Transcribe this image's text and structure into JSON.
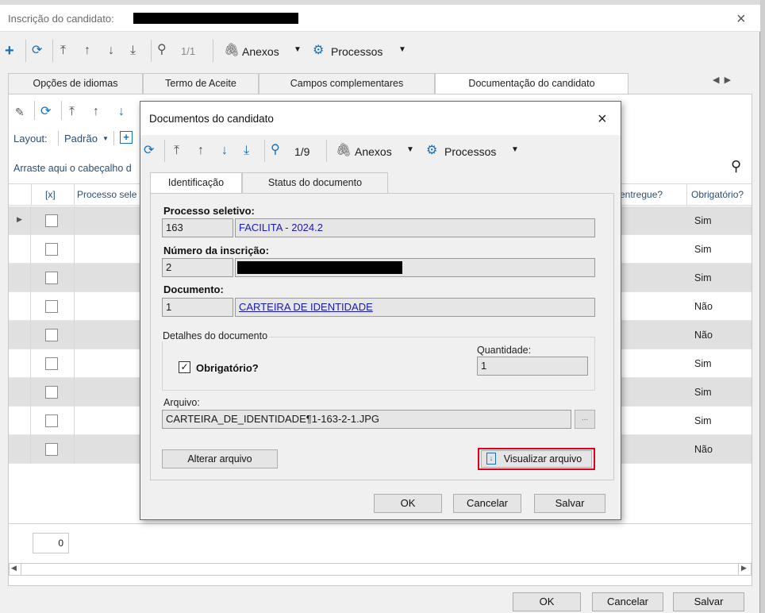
{
  "window": {
    "title": "Inscrição do candidato:",
    "toolbar": {
      "page": "1/1",
      "anexos": "Anexos",
      "processos": "Processos"
    },
    "tabs": [
      "Opções de idiomas",
      "Termo de Aceite",
      "Campos complementares",
      "Documentação do candidato"
    ],
    "inner_toolbar": {
      "layout_label": "Layout:",
      "layout_value": "Padrão"
    },
    "group_hint": "Arraste aqui o cabeçalho d",
    "columns": {
      "check": "[x]",
      "processo": "Processo sele",
      "entregue": "entregue?",
      "obrigatorio": "Obrigatório?"
    },
    "rows": [
      "Sim",
      "Sim",
      "Sim",
      "Não",
      "Não",
      "Sim",
      "Sim",
      "Sim",
      "Não"
    ],
    "count": "0",
    "buttons": {
      "ok": "OK",
      "cancel": "Cancelar",
      "save": "Salvar"
    }
  },
  "modal": {
    "title": "Documentos do candidato",
    "toolbar": {
      "page": "1/9",
      "anexos": "Anexos",
      "processos": "Processos"
    },
    "tabs": [
      "Identificação",
      "Status do documento"
    ],
    "processo": {
      "label": "Processo seletivo:",
      "code": "163",
      "name": "FACILITA - 2024.2"
    },
    "inscricao": {
      "label": "Número da inscrição:",
      "code": "2"
    },
    "documento": {
      "label": "Documento:",
      "code": "1",
      "name": "CARTEIRA DE IDENTIDADE"
    },
    "detalhes": {
      "legend": "Detalhes do documento",
      "obrigatorio_label": "Obrigatório?",
      "obrigatorio_checked": true,
      "quantidade_label": "Quantidade:",
      "quantidade": "1"
    },
    "arquivo": {
      "label": "Arquivo:",
      "value": "CARTEIRA_DE_IDENTIDADE¶1-163-2-1.JPG",
      "browse": "..."
    },
    "alterar": "Alterar arquivo",
    "visualizar": "Visualizar arquivo",
    "buttons": {
      "ok": "OK",
      "cancel": "Cancelar",
      "save": "Salvar"
    }
  }
}
